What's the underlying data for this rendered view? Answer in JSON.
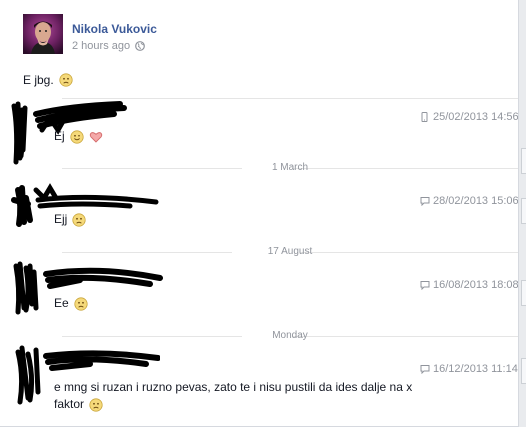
{
  "post": {
    "author": "Nikola Vukovic",
    "time": "2 hours ago",
    "text": "E jbg."
  },
  "messages": [
    {
      "timestamp": "25/02/2013 14:56",
      "text": "Ej",
      "source": "mobile"
    },
    {
      "separator": "1 March"
    },
    {
      "timestamp": "28/02/2013 15:06",
      "text": "Ejj",
      "source": "chat"
    },
    {
      "separator": "17 August"
    },
    {
      "timestamp": "16/08/2013 18:08",
      "text": "Ee",
      "source": "chat"
    },
    {
      "separator": "Monday"
    },
    {
      "timestamp": "16/12/2013 11:14",
      "text_line1": "e mng si ruzan i ruzno pevas, zato te i nisu pustili da ides dalje na x",
      "text_line2": "faktor",
      "source": "chat"
    }
  ],
  "icons": {
    "privacy": "globe-icon",
    "sad": "sad-face-emoji",
    "wink": "wink-emoji",
    "heart": "heart-emoji",
    "mobile": "mobile-icon",
    "chat": "chat-bubble-icon"
  },
  "colors": {
    "name": "#3b5998",
    "meta": "#90949c",
    "text": "#141823",
    "divider": "#e5e5e5"
  }
}
